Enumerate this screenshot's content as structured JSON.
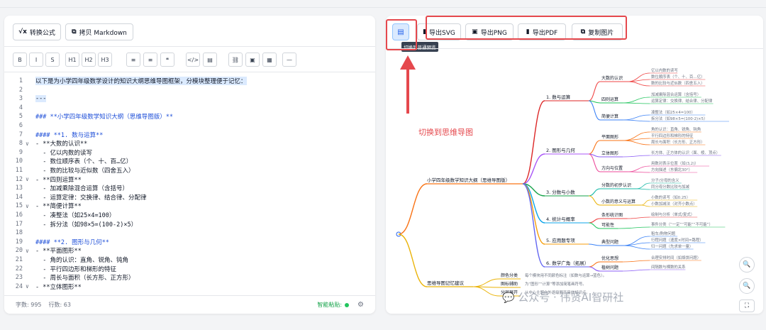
{
  "left_toolbar": {
    "convert_formula": "转换公式",
    "copy_markdown": "拷贝 Markdown"
  },
  "format_buttons": [
    "B",
    "I",
    "S",
    "H1",
    "H2",
    "H3",
    "≡",
    "≡",
    "❝",
    "</>",
    "▤",
    "⛓",
    "▣",
    "▦",
    "—"
  ],
  "editor_lines": [
    {
      "n": "1",
      "text": "以下是为小学四年级数学设计的知识大纲思维导图框架，分模块整理便于记忆：",
      "kind": "sel"
    },
    {
      "n": "2",
      "text": "",
      "kind": ""
    },
    {
      "n": "3",
      "text": "---",
      "kind": "sel"
    },
    {
      "n": "4",
      "text": "",
      "kind": ""
    },
    {
      "n": "5",
      "text": "### **小学四年级数学知识大纲（思维导图版）**",
      "kind": "h"
    },
    {
      "n": "6",
      "text": "",
      "kind": ""
    },
    {
      "n": "7",
      "text": "#### **1. 数与运算**",
      "kind": "h"
    },
    {
      "n": "8",
      "text": "- **大数的认识**",
      "kind": "",
      "fold": "∨"
    },
    {
      "n": "9",
      "text": "  - 亿以内数的读写",
      "kind": ""
    },
    {
      "n": "10",
      "text": "  - 数位顺序表（个、十、百…亿）",
      "kind": ""
    },
    {
      "n": "11",
      "text": "  - 数的比较与近似数（四舍五入）",
      "kind": ""
    },
    {
      "n": "12",
      "text": "- **四则运算**",
      "kind": "",
      "fold": "∨"
    },
    {
      "n": "13",
      "text": "  - 加减乘除混合运算（含括号）",
      "kind": ""
    },
    {
      "n": "14",
      "text": "  - 运算定律：交换律、结合律、分配律",
      "kind": ""
    },
    {
      "n": "15",
      "text": "- **简便计算**",
      "kind": "",
      "fold": "∨"
    },
    {
      "n": "16",
      "text": "  - 凑整法（如25×4=100）",
      "kind": ""
    },
    {
      "n": "17",
      "text": "  - 拆分法（如98×5=(100-2)×5）",
      "kind": ""
    },
    {
      "n": "18",
      "text": "",
      "kind": ""
    },
    {
      "n": "19",
      "text": "#### **2. 图形与几何**",
      "kind": "h"
    },
    {
      "n": "20",
      "text": "- **平面图形**",
      "kind": "",
      "fold": "∨"
    },
    {
      "n": "21",
      "text": "  - 角的认识：直角、锐角、钝角",
      "kind": ""
    },
    {
      "n": "22",
      "text": "  - 平行四边形和梯形的特征",
      "kind": ""
    },
    {
      "n": "23",
      "text": "  - 周长与面积（长方形、正方形）",
      "kind": ""
    },
    {
      "n": "24",
      "text": "- **立体图形**",
      "kind": "",
      "fold": "∨"
    }
  ],
  "status": {
    "chars": "字数: 995",
    "lines": "行数: 63",
    "smart_paste": "智能粘贴:"
  },
  "right_toolbar": {
    "tooltip": "切换到普通预览",
    "export_svg": "导出SVG",
    "export_png": "导出PNG",
    "export_pdf": "导出PDF",
    "copy_image": "复制图片"
  },
  "annotation": "切换到思维导图",
  "watermark": "公众号 · 伟贤AI智研社",
  "mindmap": {
    "root": "小学四年级数学知识大纲（思维导图版）",
    "tips": "思维导图记忆建议",
    "sections": [
      {
        "label": "1. 数与运算",
        "children": [
          {
            "label": "大数的认识",
            "leaves": [
              "亿以内数的读写",
              "数位顺序表（个、十、百…亿）",
              "数的比较与近似数（四舍五入）"
            ]
          },
          {
            "label": "四则运算",
            "leaves": [
              "加减乘除混合运算（含括号）",
              "运算定律：交换律、结合律、分配律"
            ]
          },
          {
            "label": "简便计算",
            "leaves": [
              "凑整法（如25×4=100）",
              "拆分法（如98×5=(100-2)×5）"
            ]
          }
        ]
      },
      {
        "label": "2. 图形与几何",
        "children": [
          {
            "label": "平面图形",
            "leaves": [
              "角的认识：直角、锐角、钝角",
              "平行四边形和梯形的特征",
              "周长与面积（长方形、正方形）"
            ]
          },
          {
            "label": "立体图形",
            "leaves": [
              "长方体、正方体的认识（面、棱、顶点）"
            ]
          },
          {
            "label": "方向与位置",
            "leaves": [
              "用数对表示位置（如(3,2)）",
              "方向描述（东偏北30°）"
            ]
          }
        ]
      },
      {
        "label": "3. 分数与小数",
        "children": [
          {
            "label": "分数的初步认识",
            "leaves": [
              "分子/分母的含义",
              "同分母分数比较与加减"
            ]
          },
          {
            "label": "小数的意义与运算",
            "leaves": [
              "小数的读写（如0.25）",
              "小数加减法（对齐小数点）"
            ]
          }
        ]
      },
      {
        "label": "4. 统计与概率",
        "children": [
          {
            "label": "条形统计图",
            "leaves": [
              "绘制与分析（单式/复式）"
            ]
          },
          {
            "label": "可能性",
            "leaves": [
              "事件分类（“一定”“可能”“不可能”）"
            ]
          }
        ]
      },
      {
        "label": "5. 应用题专项",
        "children": [
          {
            "label": "典型问题",
            "leaves": [
              "租车/购物问题",
              "行程问题（速度×时间=路程）",
              "归一问题（先求单一量）"
            ]
          }
        ]
      },
      {
        "label": "6. 数学广角（拓展）",
        "children": [
          {
            "label": "优化思想",
            "leaves": [
              "合理安排时间（如烙饼问题）"
            ]
          },
          {
            "label": "植树问题",
            "leaves": [
              "间隔数与棵数的关系"
            ]
          }
        ]
      }
    ],
    "tip_items": [
      {
        "label": "颜色分类",
        "text": "每个模块用不同颜色标注（如数与运算→蓝色）。"
      },
      {
        "label": "图标辅助",
        "text": "为“图形”“计算”等添加简笔画符号。"
      },
      {
        "label": "分层展开",
        "text": "从中心主题向外逐级展开具体知识点。"
      }
    ]
  },
  "colors": {
    "brand": "#2563eb",
    "red": "#e5484d",
    "green": "#22c55e"
  }
}
